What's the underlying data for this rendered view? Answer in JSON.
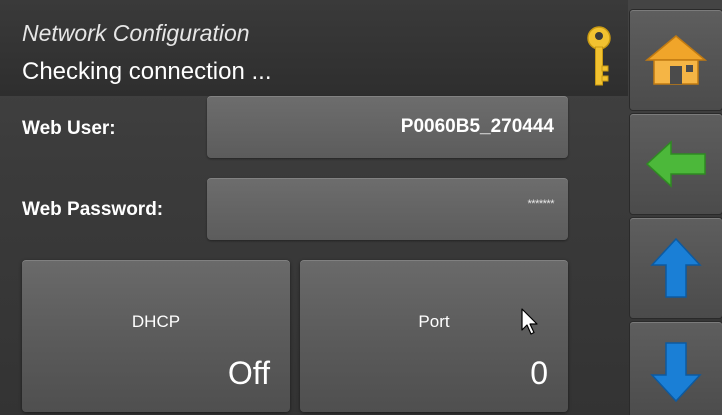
{
  "header": {
    "title": "Network Configuration",
    "status": "Checking connection ..."
  },
  "fields": {
    "web_user": {
      "label": "Web User:",
      "value": "P0060B5_270444"
    },
    "web_password": {
      "label": "Web Password:",
      "value": "*******"
    }
  },
  "tiles": {
    "dhcp": {
      "title": "DHCP",
      "value": "Off"
    },
    "port": {
      "title": "Port",
      "value": "0"
    }
  },
  "sidebar": {
    "buttons": [
      "home-icon",
      "arrow-left-icon",
      "arrow-up-icon",
      "arrow-down-icon"
    ]
  },
  "colors": {
    "key_gold": "#f2c230",
    "home_orange": "#f0a52a",
    "back_green": "#4cb83a",
    "scroll_blue": "#1a7fd6"
  }
}
